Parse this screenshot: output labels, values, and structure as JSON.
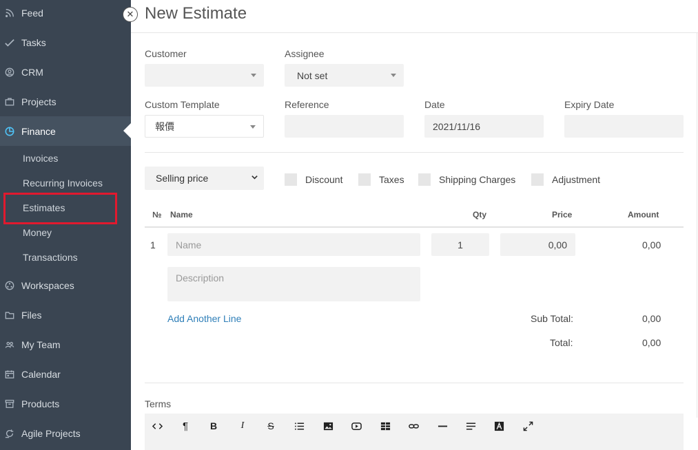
{
  "sidebar": {
    "items": [
      {
        "label": "Feed",
        "icon": "rss-icon"
      },
      {
        "label": "Tasks",
        "icon": "check-icon"
      },
      {
        "label": "CRM",
        "icon": "user-circle-icon"
      },
      {
        "label": "Projects",
        "icon": "briefcase-icon"
      },
      {
        "label": "Finance",
        "icon": "pie-chart-icon"
      },
      {
        "label": "Workspaces",
        "icon": "workspaces-icon"
      },
      {
        "label": "Files",
        "icon": "folder-icon"
      },
      {
        "label": "My Team",
        "icon": "team-icon"
      },
      {
        "label": "Calendar",
        "icon": "calendar-icon"
      },
      {
        "label": "Products",
        "icon": "box-icon"
      },
      {
        "label": "Agile Projects",
        "icon": "agile-icon"
      }
    ],
    "finance_sub": [
      "Invoices",
      "Recurring Invoices",
      "Estimates",
      "Money",
      "Transactions"
    ],
    "highlight_color": "#e2192e"
  },
  "page": {
    "title": "New Estimate",
    "close_glyph": "✕"
  },
  "form": {
    "customer_label": "Customer",
    "customer_value": "",
    "assignee_label": "Assignee",
    "assignee_value": "Not set",
    "template_label": "Custom Template",
    "template_value": "報價",
    "reference_label": "Reference",
    "reference_value": "",
    "date_label": "Date",
    "date_value": "2021/11/16",
    "expiry_label": "Expiry Date",
    "expiry_value": ""
  },
  "options": {
    "price_select": "Selling price",
    "checks": [
      "Discount",
      "Taxes",
      "Shipping Charges",
      "Adjustment"
    ]
  },
  "table": {
    "headers": {
      "num": "№",
      "name": "Name",
      "qty": "Qty",
      "price": "Price",
      "amount": "Amount"
    },
    "row": {
      "num": "1",
      "name_placeholder": "Name",
      "qty": "1",
      "price": "0,00",
      "amount": "0,00",
      "description_placeholder": "Description"
    },
    "add_line": "Add Another Line",
    "subtotal_label": "Sub Total:",
    "subtotal_value": "0,00",
    "total_label": "Total:",
    "total_value": "0,00"
  },
  "terms": {
    "label": "Terms",
    "toolbar": [
      "code-icon",
      "paragraph-icon",
      "bold-icon",
      "italic-icon",
      "strikethrough-icon",
      "list-icon",
      "image-icon",
      "video-icon",
      "table-icon",
      "link-icon",
      "horizontal-rule-icon",
      "align-icon",
      "font-color-icon",
      "fullscreen-icon"
    ]
  }
}
